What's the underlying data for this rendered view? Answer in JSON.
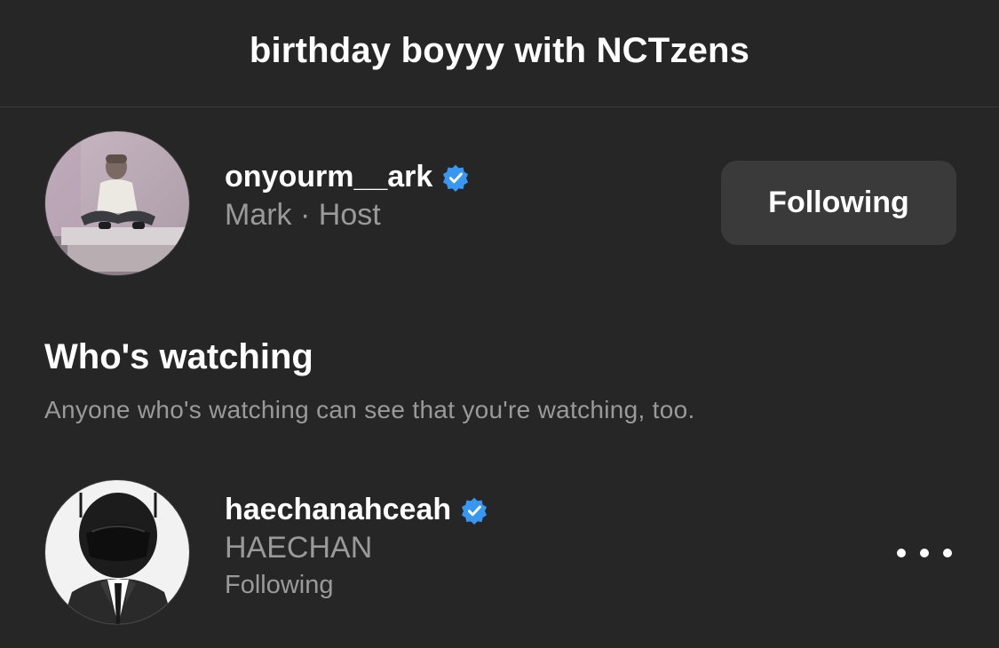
{
  "header": {
    "title": "birthday boyyy with NCTzens"
  },
  "host": {
    "username": "onyourm__ark",
    "verified": true,
    "name_role": "Mark · Host",
    "follow_label": "Following"
  },
  "watching": {
    "title": "Who's watching",
    "subtitle": "Anyone who's watching can see that you're watching, too."
  },
  "viewers": [
    {
      "username": "haechanahceah",
      "verified": true,
      "display_name": "HAECHAN",
      "status": "Following"
    }
  ],
  "colors": {
    "background": "#262626",
    "verified_badge": "#3897f0",
    "button_bg": "#3a3a3a",
    "secondary_text": "#9a9a9a"
  },
  "icons": {
    "verified": "verified-badge-icon",
    "more": "more-options-icon"
  }
}
